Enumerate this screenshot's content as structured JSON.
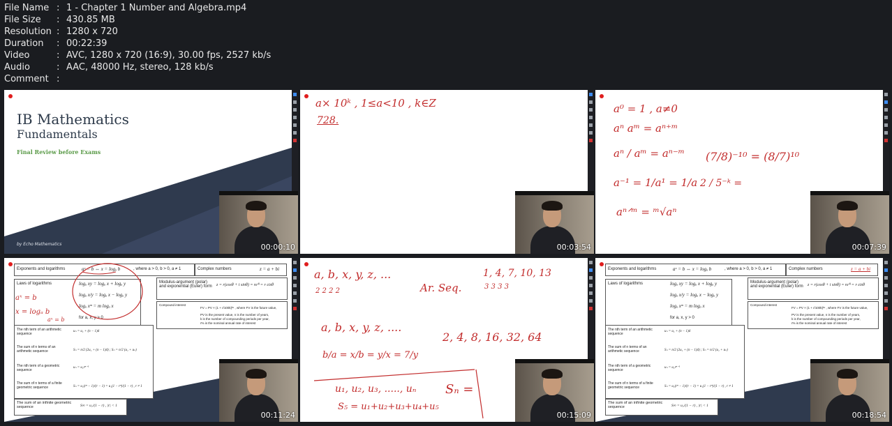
{
  "file_info": [
    {
      "key": "File Name",
      "value": "1 - Chapter 1 Number and Algebra.mp4"
    },
    {
      "key": "File Size",
      "value": "430.85 MB"
    },
    {
      "key": "Resolution",
      "value": "1280 x 720"
    },
    {
      "key": "Duration",
      "value": "00:22:39"
    },
    {
      "key": "Video",
      "value": "AVC, 1280 x 720 (16:9), 30.00 fps, 2527 kb/s"
    },
    {
      "key": "Audio",
      "value": "AAC, 48000 Hz, stereo, 128 kb/s"
    },
    {
      "key": "Comment",
      "value": ""
    }
  ],
  "separator": ":",
  "thumbnails": [
    {
      "timecode": "00:00:10"
    },
    {
      "timecode": "00:03:54"
    },
    {
      "timecode": "00:07:39"
    },
    {
      "timecode": "00:11:24"
    },
    {
      "timecode": "00:15:09"
    },
    {
      "timecode": "00:18:54"
    }
  ],
  "slide1": {
    "title": "IB Mathematics",
    "subtitle": "Fundamentals",
    "tagline": "Final Review before Exams",
    "byline": "by Echo Mathematics"
  },
  "slide2": {
    "line1": "a× 10ᵏ ,  1≤a<10  , k∈Z",
    "line2": "728."
  },
  "slide3": {
    "l1": "a⁰ = 1   ,  a≠0",
    "l2": "aⁿ aᵐ = aⁿ⁺ᵐ",
    "l3": "aⁿ / aᵐ = aⁿ⁻ᵐ",
    "l4": "a⁻¹ = 1/a¹ = 1/a",
    "l5": "aⁿᐟᵐ = ᵐ√aⁿ",
    "r1": "(7/8)⁻¹⁰ = (8/7)¹⁰",
    "r2": "2 / 5⁻ᵏ ="
  },
  "formula_sheet": {
    "exp_label": "Exponents and logarithms",
    "exp_formula": "aˣ = b ⇔ x = logₐ b",
    "exp_cond": ", where a > 0, b > 0, a ≠ 1",
    "complex_label": "Complex numbers",
    "complex_formula": "z = a + bi",
    "laws_label": "Laws of logarithms",
    "law1": "logₐ xy = logₐ x + logₐ y",
    "law2": "logₐ x/y = logₐ x − logₐ y",
    "law3": "logₐ xᵐ = m logₐ x",
    "law_cond": "for a, x, y > 0",
    "modarg_label": "Modulus-argument (polar) and exponential (Euler) form",
    "modarg_formula": "z = r(cosθ + i sinθ) = reⁱᶿ = r cisθ",
    "ci_label": "Compound interest",
    "ci_formula": "FV = PV × (1 + r/100k)ᵏⁿ , where FV is the future value,",
    "ci_note1": "PV is the present value, n is the number of years,",
    "ci_note2": "k is the number of compounding periods per year,",
    "ci_note3": "r% is the nominal annual rate of interest",
    "arith_nth_label": "The nth term of an arithmetic sequence",
    "arith_nth": "uₙ = u₁ + (n − 1)d",
    "arith_sum_label": "The sum of n terms of an arithmetic sequence",
    "arith_sum": "Sₙ = n/2 (2u₁ + (n − 1)d) ;  Sₙ = n/2 (u₁ + uₙ)",
    "geo_nth_label": "The nth term of a geometric sequence",
    "geo_nth": "uₙ = u₁rⁿ⁻¹",
    "geo_sum_label": "The sum of n terms of a finite geometric sequence",
    "geo_sum": "Sₙ = u₁(rⁿ − 1)/(r − 1) = u₁(1 − rⁿ)/(1 − r) , r ≠ 1",
    "inf_label": "The sum of an infinite geometric sequence",
    "inf_formula": "S∞ = u₁/(1 − r) , |r| < 1"
  },
  "slide4_notes": {
    "n1": "aˣ = b",
    "n2": "x = logₐ b",
    "n3": "aˣ = b"
  },
  "slide5": {
    "l1": "a, b, x, y, z, ...",
    "l1d": "2  2  2  2",
    "seq_label": "Ar. Seq.",
    "seq_vals": "1, 4, 7, 10, 13",
    "seq_diffs": "3  3  3  3",
    "l2": "a, b, x, y, z, ....",
    "geo_vals": "2, 4, 8, 16, 32, 64",
    "ratio": "b/a = x/b = y/x = 7/y",
    "terms": "u₁, u₂, u₃, ....., uₙ",
    "sn": "Sₙ =",
    "s5": "S₅ = u₁+u₂+u₃+u₄+u₅"
  },
  "slide6_notes": {
    "complex_mark": "z = a + bi"
  },
  "colors": {
    "background": "#1a1c20",
    "ink_red": "#c22c2c",
    "slide_navy": "#2f3a4e",
    "tagline_green": "#5a9a48"
  }
}
